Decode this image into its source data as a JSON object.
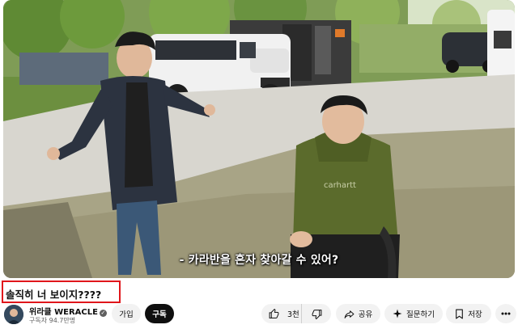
{
  "video": {
    "subtitle": "- 카라반을 혼자 찾아갈 수 있어?"
  },
  "title": "솔직히 너 보이지????",
  "channel": {
    "name": "위라클 WERACLE",
    "subscribers": "구독자 94.7만명"
  },
  "buttons": {
    "join": "가입",
    "subscribe": "구독",
    "like_count": "3천",
    "share": "공유",
    "ask": "질문하기",
    "save": "저장"
  },
  "colors": {
    "title_highlight": "#e0161b",
    "subscribe_bg": "#0f0f0f",
    "pill_bg": "#f2f2f2"
  },
  "icons": [
    "verified-icon",
    "thumb-up-icon",
    "thumb-down-icon",
    "share-icon",
    "sparkle-icon",
    "bookmark-icon",
    "more-icon"
  ]
}
